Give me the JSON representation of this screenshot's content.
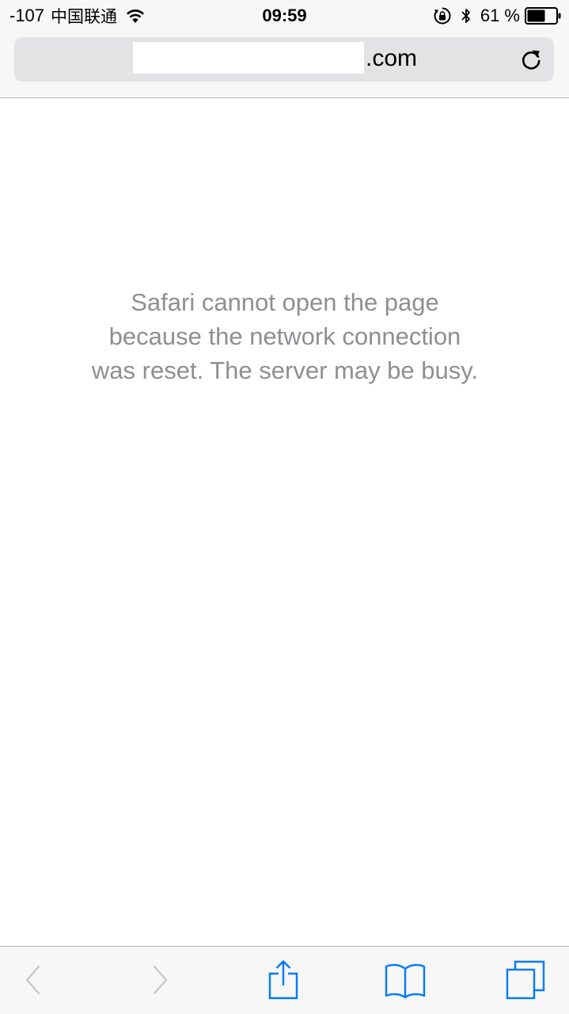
{
  "status_bar": {
    "signal": "-107",
    "carrier": "中国联通",
    "time": "09:59",
    "battery_percent": "61 %",
    "icons": [
      "wifi-icon",
      "rotation-lock-icon",
      "bluetooth-icon",
      "battery-icon"
    ]
  },
  "address_bar": {
    "url_suffix": ".com",
    "reload_icon": "reload-icon"
  },
  "error": {
    "line1": "Safari cannot open the page",
    "line2": "because the network connection",
    "line3": "was reset. The server may be busy."
  },
  "toolbar": {
    "icons": [
      "back-icon",
      "forward-icon",
      "share-icon",
      "bookmarks-icon",
      "tabs-icon"
    ]
  },
  "colors": {
    "accent": "#007aff",
    "disabled": "#c7c7cc",
    "error_text": "#8e8e93",
    "chrome_bg": "#f7f7f7",
    "url_field_bg": "#e3e3e5"
  }
}
